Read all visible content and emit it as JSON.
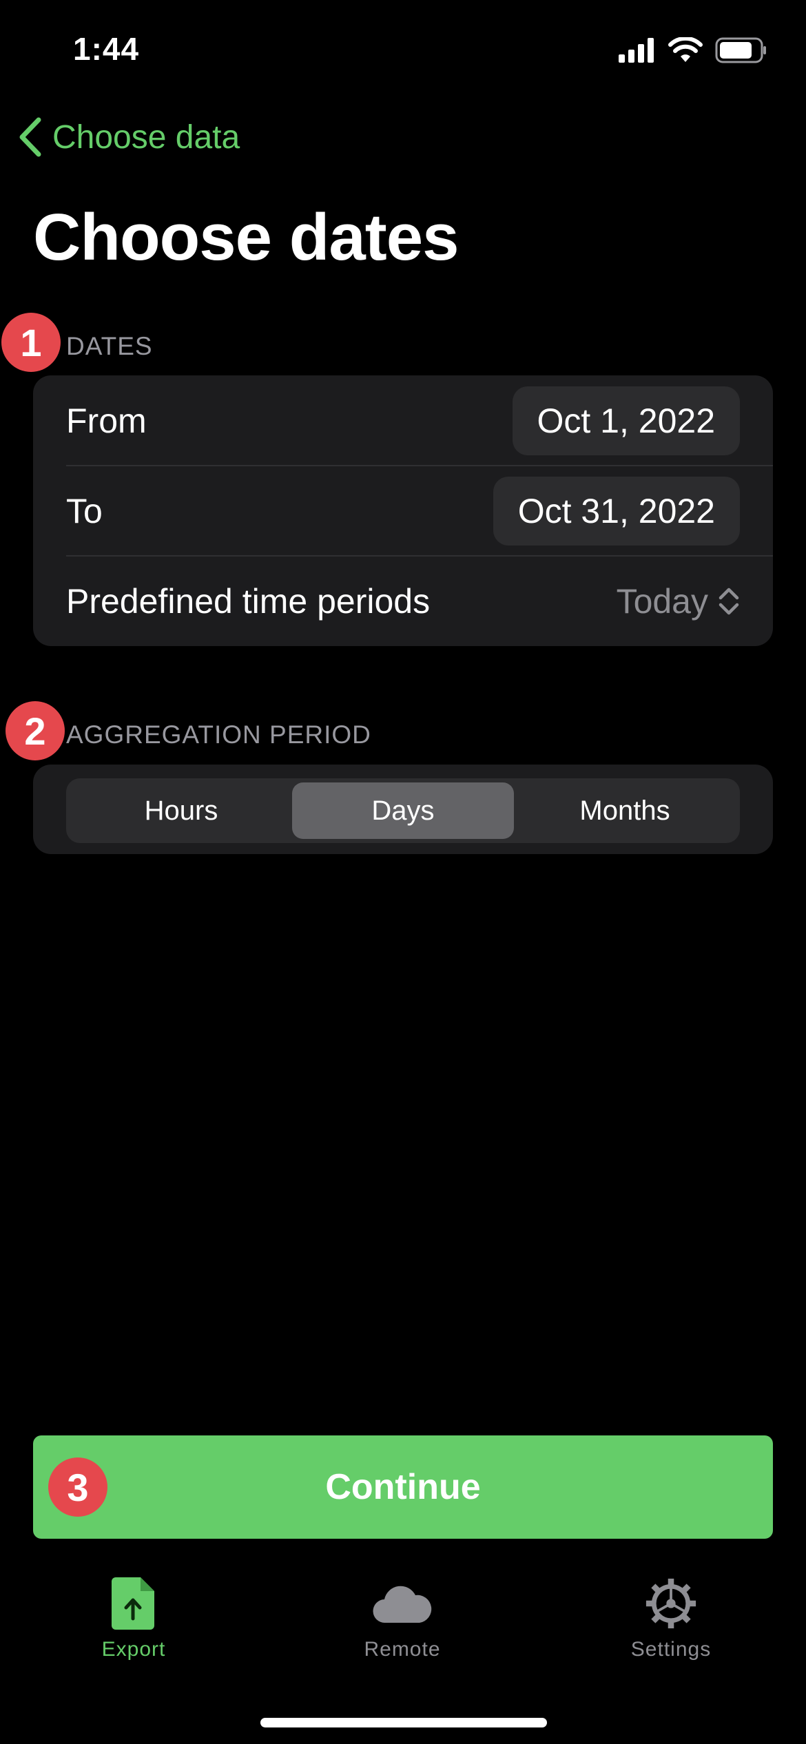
{
  "status_bar": {
    "time": "1:44"
  },
  "nav": {
    "back_label": "Choose data",
    "title": "Choose dates"
  },
  "dates_section": {
    "badge": "1",
    "header": "DATES",
    "rows": [
      {
        "label": "From",
        "value": "Oct 1, 2022"
      },
      {
        "label": "To",
        "value": "Oct 31, 2022"
      }
    ],
    "predefined": {
      "label": "Predefined time periods",
      "value": "Today"
    }
  },
  "aggregation_section": {
    "badge": "2",
    "header": "AGGREGATION PERIOD",
    "options": [
      "Hours",
      "Days",
      "Months"
    ],
    "selected": "Days"
  },
  "continue_button": {
    "badge": "3",
    "label": "Continue"
  },
  "tab_bar": {
    "tabs": [
      {
        "label": "Export",
        "icon": "export-doc-icon",
        "active": true
      },
      {
        "label": "Remote",
        "icon": "cloud-icon",
        "active": false
      },
      {
        "label": "Settings",
        "icon": "gear-icon",
        "active": false
      }
    ]
  },
  "colors": {
    "accent": "#65cd69",
    "badge": "#e5484d",
    "card": "#1c1c1e",
    "inactive": "#8e8e93"
  }
}
